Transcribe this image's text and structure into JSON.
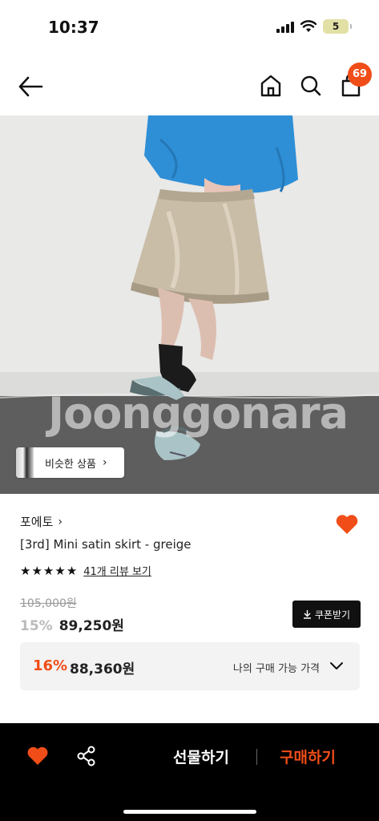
{
  "status_bar": {
    "time": "10:37",
    "battery": "5"
  },
  "nav": {
    "cart_count": "69",
    "icons": [
      "back-arrow-icon",
      "home-icon",
      "search-icon",
      "shopping-bag-icon"
    ]
  },
  "image": {
    "watermark": "Joonggonara",
    "similar_label": "비슷한 상품",
    "chevron": "›"
  },
  "product": {
    "brand": "포에토",
    "brand_chevron": "›",
    "title": "[3rd] Mini satin skirt - greige",
    "rating": 5,
    "review_link": "41개 리뷰 보기",
    "original_price": "105,000원",
    "discount": "15%",
    "price": "89,250원",
    "coupon_label": "쿠폰받기",
    "favorited": true
  },
  "my_price": {
    "discount": "16%",
    "price": "88,360원",
    "label": "나의 구매 가능 가격"
  },
  "bottom_bar": {
    "gift_label": "선물하기",
    "buy_label": "구매하기"
  },
  "colors": {
    "accent": "#f04d18",
    "dark": "#111111",
    "panel": "#f3f3f3"
  }
}
